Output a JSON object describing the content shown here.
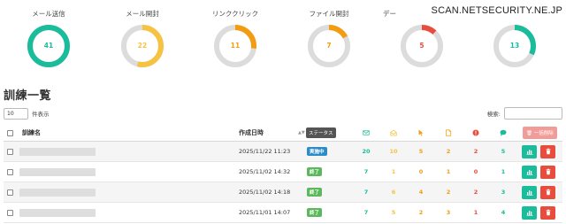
{
  "watermark": "SCAN.NETSECURITY.NE.JP",
  "colors": {
    "accent": "#1abc9c",
    "ring_track": "#dcdcdc",
    "mail_open": "#f5c242",
    "link_click": "#f39c12",
    "danger": "#e74c3c",
    "status_active": "#2c8cc9",
    "status_done": "#5cb85c"
  },
  "stats": [
    {
      "title": "メール送信",
      "value": "41",
      "fill": 1.0,
      "color": "#1abc9c"
    },
    {
      "title": "メール開封",
      "value": "22",
      "fill": 0.54,
      "color": "#f5c242"
    },
    {
      "title": "リンククリック",
      "value": "11",
      "fill": 0.27,
      "color": "#f39c12"
    },
    {
      "title": "ファイル開封",
      "value": "7",
      "fill": 0.17,
      "color": "#f39c12"
    },
    {
      "title": "デー",
      "value": "5",
      "fill": 0.12,
      "color": "#e74c3c"
    },
    {
      "title": "",
      "value": "13",
      "fill": 0.32,
      "color": "#1abc9c"
    }
  ],
  "page_title": "訓練一覧",
  "length": {
    "value": "10",
    "label": "件表示"
  },
  "search": {
    "label": "検索:"
  },
  "table": {
    "headers": {
      "name": "訓練名",
      "created": "作成日時",
      "status": "ステータス",
      "bulk_delete": "一括削除"
    },
    "header_icons": [
      "envelope-icon",
      "envelope-open-icon",
      "cursor-icon",
      "file-icon",
      "alert-icon",
      "chat-icon"
    ],
    "rows": [
      {
        "created": "2025/11/22 11:23",
        "status": "実施中",
        "status_color": "#2c8cc9",
        "counts": [
          "20",
          "10",
          "5",
          "2",
          "2",
          "5"
        ]
      },
      {
        "created": "2025/11/02 14:32",
        "status": "終了",
        "status_color": "#5cb85c",
        "counts": [
          "7",
          "1",
          "0",
          "1",
          "0",
          "1"
        ]
      },
      {
        "created": "2025/11/02 14:18",
        "status": "終了",
        "status_color": "#5cb85c",
        "counts": [
          "7",
          "6",
          "4",
          "2",
          "2",
          "3"
        ]
      },
      {
        "created": "2025/11/01 14:07",
        "status": "終了",
        "status_color": "#5cb85c",
        "counts": [
          "7",
          "5",
          "2",
          "3",
          "1",
          "4"
        ]
      }
    ]
  }
}
